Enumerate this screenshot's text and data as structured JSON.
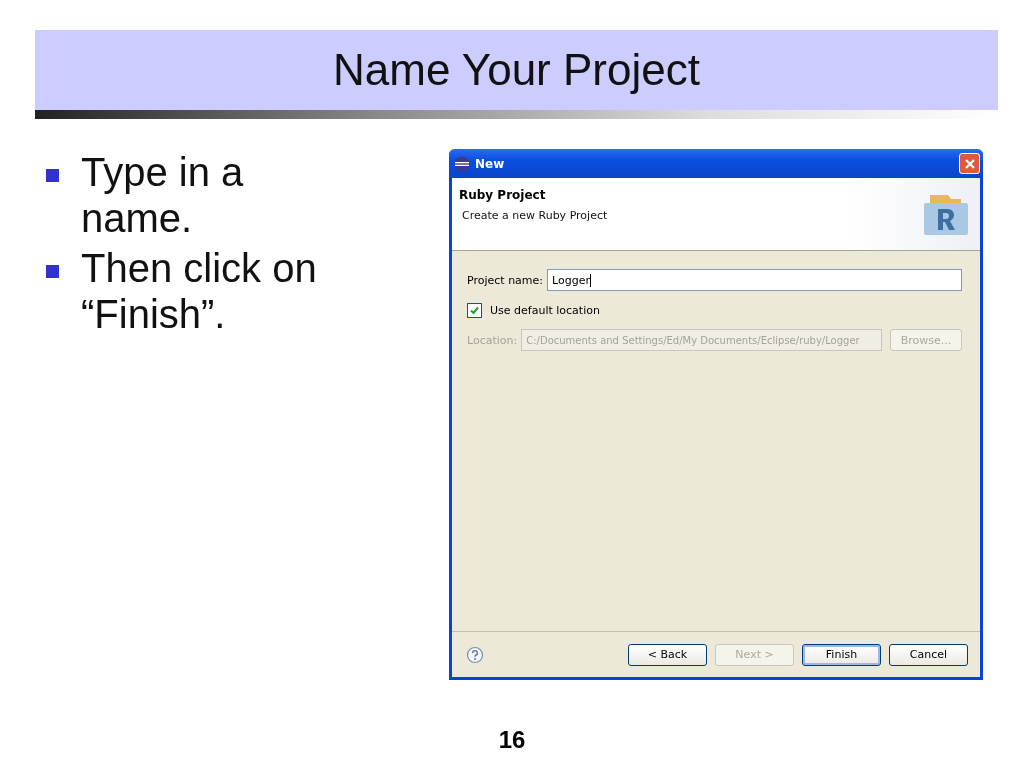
{
  "slide": {
    "title": "Name Your Project",
    "bullets": [
      "Type in a name.",
      "Then click on “Finish”."
    ],
    "page_number": "16"
  },
  "dialog": {
    "title": "New",
    "header": {
      "title": "Ruby Project",
      "description": "Create a new Ruby Project"
    },
    "project_name": {
      "label": "Project name:",
      "value": "Logger"
    },
    "use_default_location": {
      "label": "Use default location",
      "checked": true
    },
    "location": {
      "label": "Location:",
      "value": "C:/Documents and Settings/Ed/My Documents/Eclipse/ruby/Logger",
      "disabled": true
    },
    "browse_button": {
      "label": "Browse...",
      "disabled": true
    },
    "buttons": [
      {
        "label": "< Back",
        "disabled": false,
        "default": false
      },
      {
        "label": "Next >",
        "disabled": true,
        "default": false
      },
      {
        "label": "Finish",
        "disabled": false,
        "default": true
      },
      {
        "label": "Cancel",
        "disabled": false,
        "default": false
      }
    ]
  }
}
